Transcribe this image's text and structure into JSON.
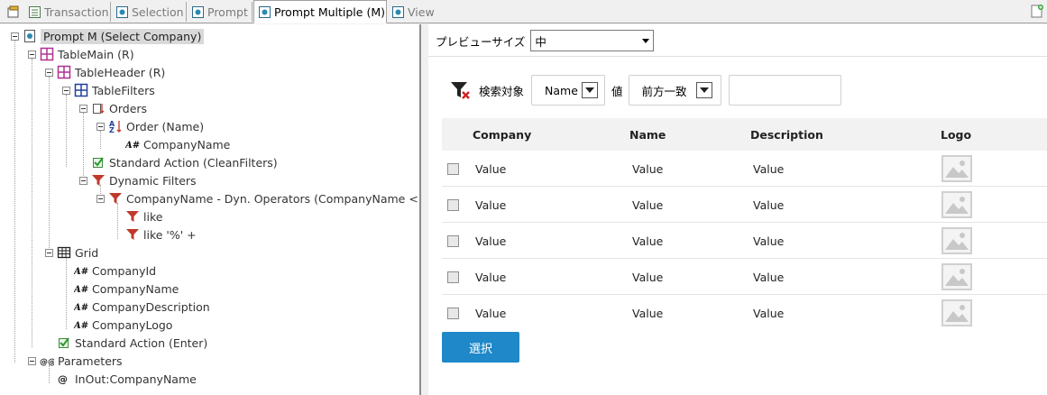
{
  "tabs": [
    {
      "label": "Transaction",
      "active": false
    },
    {
      "label": "Selection",
      "active": false
    },
    {
      "label": "Prompt",
      "active": false
    },
    {
      "label": "Prompt Multiple (M)",
      "active": true
    },
    {
      "label": "View",
      "active": false
    }
  ],
  "tree": {
    "nodes": [
      {
        "label": "Prompt M (Select Company)",
        "icon": "prompt-object-icon"
      },
      {
        "label": "TableMain (R)",
        "icon": "table-main-icon"
      },
      {
        "label": "TableHeader (R)",
        "icon": "table-header-icon"
      },
      {
        "label": "TableFilters",
        "icon": "table-filters-icon"
      },
      {
        "label": "Orders",
        "icon": "orders-icon"
      },
      {
        "label": "Order (Name)",
        "icon": "sort-az-icon"
      },
      {
        "label": "CompanyName",
        "icon": "attribute-icon"
      },
      {
        "label": "Standard Action (CleanFilters)",
        "icon": "standard-action-icon"
      },
      {
        "label": "Dynamic Filters",
        "icon": "filter-icon"
      },
      {
        "label": "CompanyName - Dyn. Operators (CompanyName <",
        "icon": "filter-icon"
      },
      {
        "label": "like",
        "icon": "filter-icon"
      },
      {
        "label": "like '%' +",
        "icon": "filter-icon"
      },
      {
        "label": "Grid",
        "icon": "grid-icon"
      },
      {
        "label": "CompanyId",
        "icon": "attribute-icon"
      },
      {
        "label": "CompanyName",
        "icon": "attribute-icon"
      },
      {
        "label": "CompanyDescription",
        "icon": "attribute-icon"
      },
      {
        "label": "CompanyLogo",
        "icon": "attribute-icon"
      },
      {
        "label": "Standard Action (Enter)",
        "icon": "standard-action-icon"
      },
      {
        "label": "Parameters",
        "icon": "parameters-icon"
      },
      {
        "label": "InOut:CompanyName",
        "icon": "parameter-at-icon"
      }
    ]
  },
  "preview": {
    "size_label": "プレビューサイズ",
    "size_value": "中",
    "filter": {
      "target_label": "検索対象",
      "field_value": "Name",
      "value_label": "値",
      "operator_value": "前方一致",
      "input_value": ""
    },
    "grid": {
      "columns": [
        "Company",
        "Name",
        "Description",
        "Logo"
      ],
      "rows": [
        [
          "Value",
          "Value",
          "Value"
        ],
        [
          "Value",
          "Value",
          "Value"
        ],
        [
          "Value",
          "Value",
          "Value"
        ],
        [
          "Value",
          "Value",
          "Value"
        ],
        [
          "Value",
          "Value",
          "Value"
        ]
      ]
    },
    "select_button": "選択"
  },
  "colors": {
    "accent_button": "#1e88c8",
    "filter_icon": "#c0392b",
    "table_icon": "#b03090",
    "tree_selection": "#d9d9d9"
  }
}
